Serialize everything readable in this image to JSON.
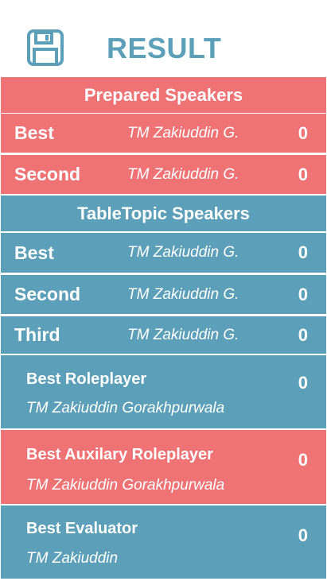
{
  "header": {
    "title": "RESULT",
    "save_icon": "floppy-disk-save-icon"
  },
  "colors": {
    "accent_blue": "#5b9fb8",
    "accent_red": "#ef7375"
  },
  "prepared": {
    "heading": "Prepared Speakers",
    "rows": [
      {
        "label": "Best",
        "name": "TM Zakiuddin G.",
        "score": "0"
      },
      {
        "label": "Second",
        "name": "TM Zakiuddin G.",
        "score": "0"
      }
    ]
  },
  "tabletopic": {
    "heading": "TableTopic Speakers",
    "rows": [
      {
        "label": "Best",
        "name": "TM Zakiuddin G.",
        "score": "0"
      },
      {
        "label": "Second",
        "name": "TM Zakiuddin G.",
        "score": "0"
      },
      {
        "label": "Third",
        "name": "TM Zakiuddin G.",
        "score": "0"
      }
    ]
  },
  "awards": [
    {
      "label": "Best Roleplayer",
      "name": "TM Zakiuddin Gorakhpurwala",
      "score": "0"
    },
    {
      "label": "Best Auxilary Roleplayer",
      "name": "TM Zakiuddin Gorakhpurwala",
      "score": "0"
    },
    {
      "label": "Best Evaluator",
      "name": "TM Zakiuddin",
      "score": "0"
    }
  ]
}
